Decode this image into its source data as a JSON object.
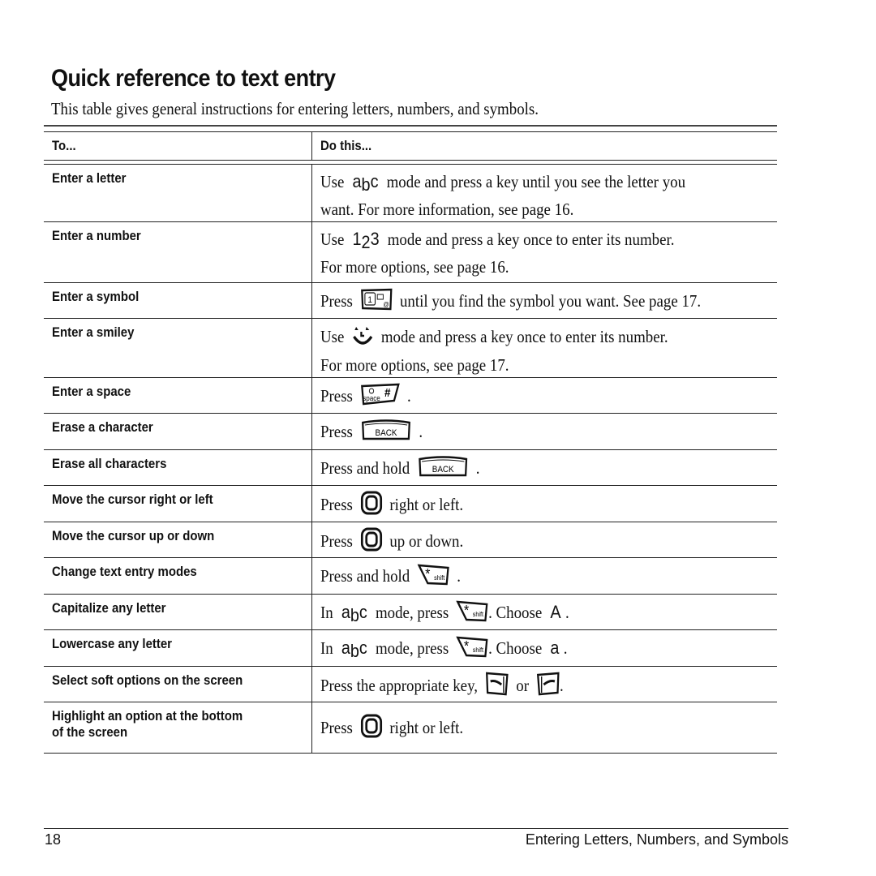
{
  "page": {
    "title": "Quick reference to text entry",
    "intro": "This table gives general instructions for entering letters, numbers, and symbols."
  },
  "table": {
    "headers": {
      "to": "To...",
      "do": "Do this..."
    },
    "rows": [
      {
        "to": "Enter a letter",
        "do": {
          "pre": "Use",
          "icon": "abc-mode-icon",
          "post": "mode and press a key until you see the letter you",
          "line2": "want. For more information, see page 16."
        }
      },
      {
        "to": "Enter a number",
        "do": {
          "pre": "Use",
          "icon": "123-mode-icon",
          "post": "mode and press a key once to enter its number.",
          "line2": "For more options, see page 16."
        }
      },
      {
        "to": "Enter a symbol",
        "do": {
          "pre": "Press",
          "icon": "symbol-key-icon",
          "post": "until you find the symbol you want. See page 17."
        }
      },
      {
        "to": "Enter a smiley",
        "do": {
          "pre": "Use",
          "icon": "smiley-mode-icon",
          "post": "mode and press a key once to enter its number.",
          "line2": "For more options, see page 17."
        }
      },
      {
        "to": "Enter a space",
        "do": {
          "pre": "Press",
          "icon": "space-key-icon",
          "post": "."
        }
      },
      {
        "to": "Erase a character",
        "do": {
          "pre": "Press",
          "icon": "back-key-icon",
          "post": "."
        }
      },
      {
        "to": "Erase all characters",
        "do": {
          "pre": "Press and hold",
          "icon": "back-key-icon",
          "post": "."
        }
      },
      {
        "to": "Move the cursor right or left",
        "do": {
          "pre": "Press",
          "icon": "navigation-key-icon",
          "post": "right or left."
        }
      },
      {
        "to": "Move the cursor up or down",
        "do": {
          "pre": "Press",
          "icon": "navigation-key-icon",
          "post": "up or down."
        }
      },
      {
        "to": "Change text entry modes",
        "do": {
          "pre": "Press and hold",
          "icon": "shift-key-icon",
          "post": "."
        }
      },
      {
        "to": "Capitalize any letter",
        "do": {
          "pre": "In",
          "icon": "abc-mode-icon",
          "mid": "mode, press",
          "icon2": "shift-key-icon",
          "mid2": ". Choose",
          "choice": "A",
          "post": "."
        }
      },
      {
        "to": "Lowercase any letter",
        "do": {
          "pre": "In",
          "icon": "abc-mode-icon",
          "mid": "mode, press",
          "icon2": "shift-key-icon",
          "mid2": ". Choose",
          "choice": "a",
          "post": "."
        }
      },
      {
        "to": "Select soft options on the screen",
        "do": {
          "pre": "Press the appropriate key,",
          "icon": "left-softkey-icon",
          "mid": "or",
          "icon2": "right-softkey-icon",
          "post": "."
        }
      },
      {
        "to": "Highlight an option at the bottom of the screen",
        "to_line1": "Highlight an option at the bottom",
        "to_line2": "of the screen",
        "do": {
          "pre": "Press",
          "icon": "navigation-key-icon",
          "post": "right or left."
        }
      }
    ]
  },
  "icons": {
    "abc_mode": {
      "a": "a",
      "b": "b",
      "c": "c"
    },
    "num_mode": {
      "one": "1",
      "two": "2",
      "three": "3"
    },
    "back_key_label": "BACK",
    "space_key_label": "space",
    "space_key_symbol": "#",
    "shift_key_symbol": "*",
    "shift_key_label": "shift",
    "symbol_key_digit": "1",
    "symbol_key_at": "@"
  },
  "footer": {
    "page_number": "18",
    "chapter": "Entering Letters, Numbers, and Symbols"
  }
}
